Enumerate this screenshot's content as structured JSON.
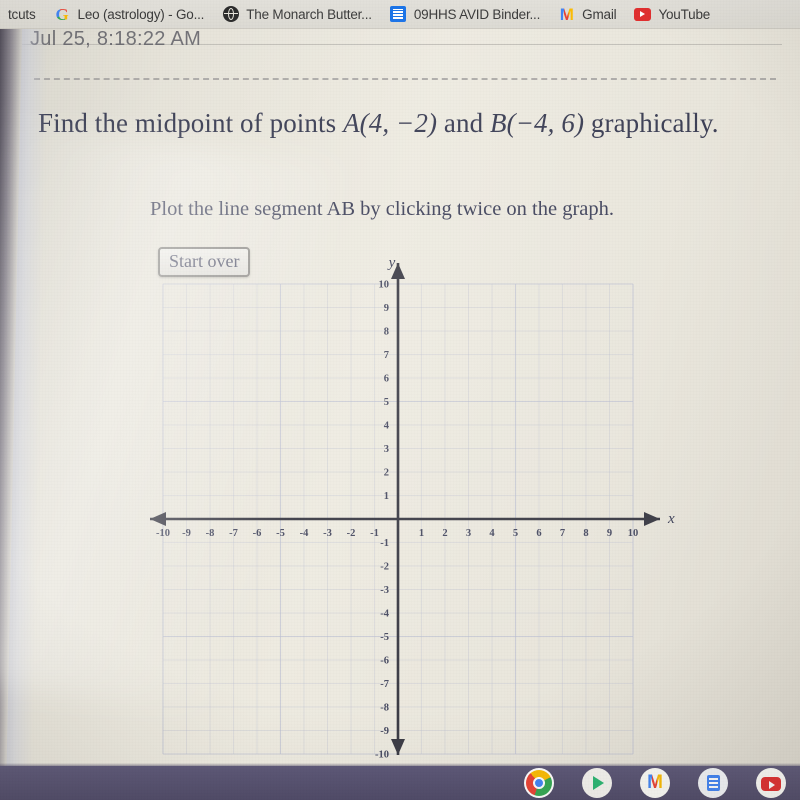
{
  "browser": {
    "bookmarks": [
      {
        "label": "tcuts",
        "icon": "none-icon"
      },
      {
        "label": "Leo (astrology) - Go...",
        "icon": "google-g-icon"
      },
      {
        "label": "The Monarch Butter...",
        "icon": "globe-icon"
      },
      {
        "label": "09HHS AVID Binder...",
        "icon": "google-sheets-icon"
      },
      {
        "label": "Gmail",
        "icon": "gmail-icon"
      },
      {
        "label": "YouTube",
        "icon": "youtube-icon"
      }
    ]
  },
  "document": {
    "timestamp": "Jul 25, 8:18:22 AM",
    "problem_text": "Find the midpoint of points ",
    "point_a": "A(4, −2)",
    "conjunction": " and ",
    "point_b": "B(−4, 6)",
    "problem_suffix": " graphically.",
    "instruction": "Plot the line segment AB by clicking twice on the graph.",
    "start_over_label": "Start over"
  },
  "taskbar": {
    "apps": [
      {
        "name": "chrome-icon"
      },
      {
        "name": "play-store-icon"
      },
      {
        "name": "gmail-icon"
      },
      {
        "name": "google-docs-icon"
      },
      {
        "name": "youtube-icon"
      }
    ]
  },
  "chart_data": {
    "type": "scatter",
    "title": "",
    "xlabel": "x",
    "ylabel": "y",
    "xlim": [
      -10,
      10
    ],
    "ylim": [
      -10,
      10
    ],
    "xticks": [
      -10,
      -9,
      -8,
      -7,
      -6,
      -5,
      -4,
      -3,
      -2,
      -1,
      1,
      2,
      3,
      4,
      5,
      6,
      7,
      8,
      9,
      10
    ],
    "yticks": [
      10,
      9,
      8,
      7,
      6,
      5,
      4,
      3,
      2,
      1,
      -1,
      -2,
      -3,
      -4,
      -5,
      -6,
      -7,
      -8,
      -9,
      -10
    ],
    "grid": true,
    "grid_step": 1,
    "axis_arrows": true,
    "series": [],
    "points": [],
    "colors": {
      "grid": "#b9bdd1",
      "axis": "#3c3c46",
      "tick_label": "#4a4d63",
      "background": "#ebe8de"
    },
    "notes": "Empty coordinate plane; student must plot A(4,-2) and B(-4,6) by clicking."
  }
}
